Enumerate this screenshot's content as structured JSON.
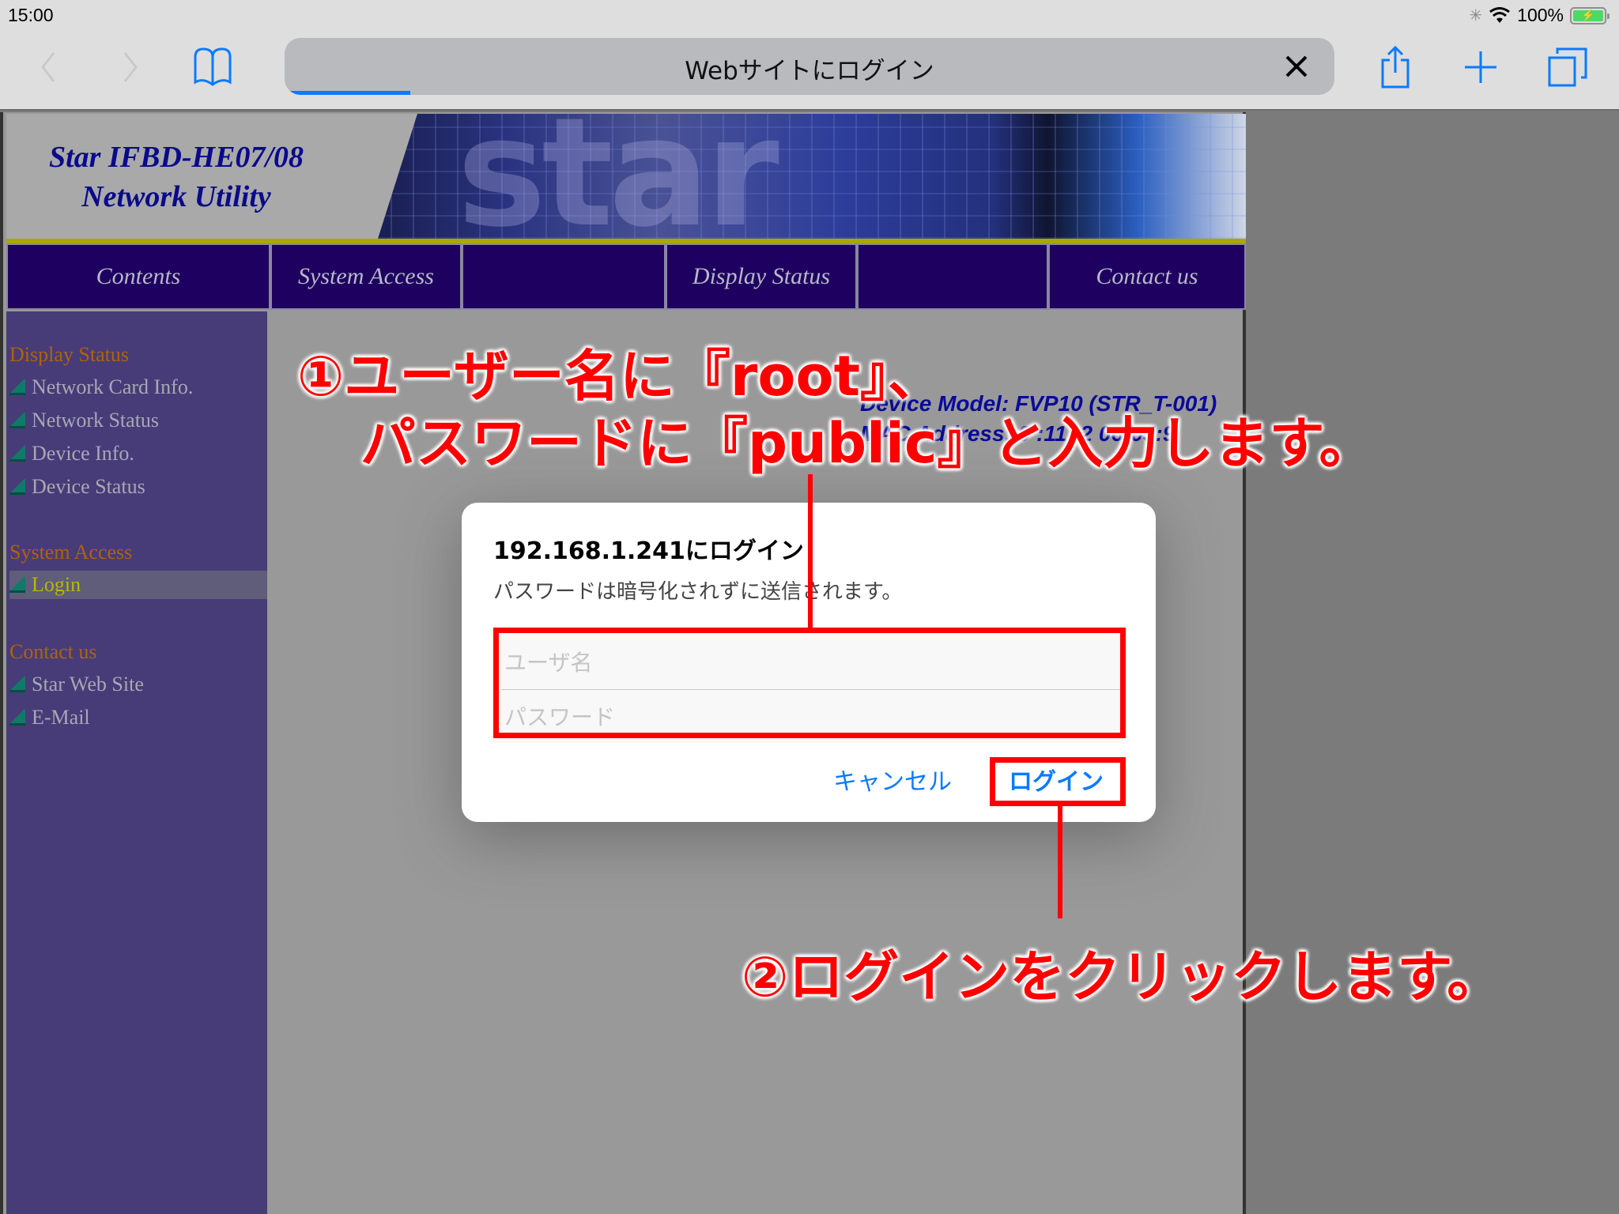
{
  "status_bar": {
    "time": "15:00",
    "battery": "100%",
    "icons": [
      "activity-spinner-icon",
      "wifi-icon",
      "battery-charging-icon"
    ]
  },
  "safari": {
    "url_title": "Webサイトにログイン",
    "load_progress": 0.12,
    "toolbar_icons": [
      "back-icon",
      "forward-icon",
      "bookmarks-icon",
      "close-icon",
      "share-icon",
      "new-tab-icon",
      "tabs-icon"
    ]
  },
  "site": {
    "title_line1": "Star IFBD-HE07/08",
    "title_line2": "Network Utility",
    "banner_word": "star",
    "nav": [
      {
        "label": "Contents"
      },
      {
        "label": "System Access"
      },
      {
        "label": ""
      },
      {
        "label": "Display Status"
      },
      {
        "label": ""
      },
      {
        "label": "Contact us"
      }
    ],
    "sidebar": {
      "sections": [
        {
          "heading": "Display Status",
          "items": [
            "Network Card Info.",
            "Network Status",
            "Device Info.",
            "Device Status"
          ]
        },
        {
          "heading": "System Access",
          "items": [
            "Login"
          ]
        },
        {
          "heading": "Contact us",
          "items": [
            "Star Web Site",
            "E-Mail"
          ]
        }
      ],
      "active_item": "Login"
    },
    "device_model": "Device Model: FVP10 (STR_T-001)",
    "mac_address": "MAC Address: 0 :11: 2 06:05:9"
  },
  "dialog": {
    "title": "192.168.1.241にログイン",
    "message": "パスワードは暗号化されずに送信されます。",
    "username_placeholder": "ユーザ名",
    "password_placeholder": "パスワード",
    "username_value": "",
    "password_value": "",
    "cancel_label": "キャンセル",
    "login_label": "ログイン"
  },
  "annotations": {
    "step1_line1": "①ユーザー名に『root』、",
    "step1_line2": "パスワードに『public』と入力します。",
    "step2": "②ログインをクリックします。",
    "color": "#ff0000"
  }
}
